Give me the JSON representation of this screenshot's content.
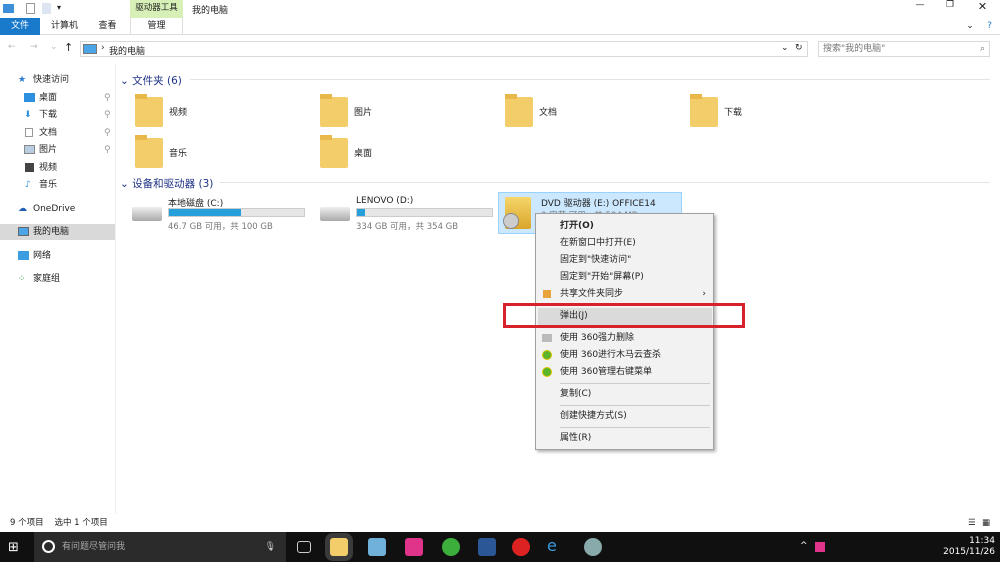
{
  "title": "我的电脑",
  "ribbon": {
    "context_group": "驱动器工具",
    "tabs": [
      "文件",
      "计算机",
      "查看",
      "管理"
    ]
  },
  "address": {
    "path": "我的电脑",
    "search_placeholder": "搜索\"我的电脑\""
  },
  "nav": {
    "quick_access": "快速访问",
    "items": [
      "桌面",
      "下载",
      "文档",
      "图片",
      "视频",
      "音乐"
    ],
    "onedrive": "OneDrive",
    "this_pc": "我的电脑",
    "network": "网络",
    "homegroup": "家庭组"
  },
  "folders": {
    "header": "文件夹 (6)",
    "items": [
      "视频",
      "图片",
      "文档",
      "下载",
      "音乐",
      "桌面"
    ]
  },
  "drives": {
    "header": "设备和驱动器 (3)",
    "items": [
      {
        "name": "本地磁盘 (C:)",
        "size": "46.7 GB 可用，共 100 GB",
        "used": 0.53
      },
      {
        "name": "LENOVO (D:)",
        "size": "334 GB 可用，共 354 GB",
        "used": 0.06
      },
      {
        "name": "DVD 驱动器 (E:) OFFICE14",
        "size": "0 字节 可用，共 504 MB",
        "used": 1
      }
    ]
  },
  "menu": {
    "items": [
      "打开(O)",
      "在新窗口中打开(E)",
      "固定到\"快速访问\"",
      "固定到\"开始\"屏幕(P)",
      "共享文件夹同步",
      "弹出(J)",
      "使用 360强力删除",
      "使用 360进行木马云查杀",
      "使用 360管理右键菜单",
      "复制(C)",
      "创建快捷方式(S)",
      "属性(R)"
    ]
  },
  "status": {
    "count": "9 个项目",
    "selected": "选中 1 个项目"
  },
  "taskbar": {
    "search": "有问题尽管问我",
    "time": "11:34",
    "date": "2015/11/26"
  },
  "colors": {
    "accent": "#1979ca",
    "highlight": "#cce8ff",
    "red_box": "#d8222b"
  }
}
